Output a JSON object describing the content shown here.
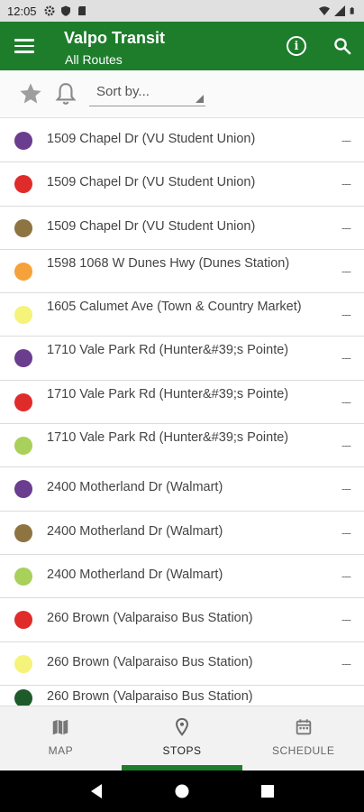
{
  "status_bar": {
    "time": "12:05"
  },
  "app_bar": {
    "title": "Valpo Transit",
    "subtitle": "All Routes"
  },
  "toolbar": {
    "sort_placeholder": "Sort by..."
  },
  "colors": {
    "primary": "#1d7d2b",
    "purple": "#6a3d8f",
    "red": "#e02b2b",
    "brown": "#8d7440",
    "orange": "#f5a23a",
    "yellow": "#f5f37a",
    "light_green": "#a9d05a",
    "dark_green": "#1e5a2a"
  },
  "stops": [
    {
      "name": "1509 Chapel Dr (VU Student Union)",
      "color": "#6a3d8f",
      "time": "---"
    },
    {
      "name": "1509 Chapel Dr (VU Student Union)",
      "color": "#e02b2b",
      "time": "---"
    },
    {
      "name": "1509 Chapel Dr (VU Student Union)",
      "color": "#8d7440",
      "time": "---"
    },
    {
      "name": "1598 1068 W Dunes Hwy (Dunes Station)",
      "color": "#f5a23a",
      "time": "---"
    },
    {
      "name": "1605 Calumet Ave (Town & Country Market)",
      "color": "#f5f37a",
      "time": "---"
    },
    {
      "name": "1710 Vale Park Rd (Hunter&#39;s Pointe)",
      "color": "#6a3d8f",
      "time": "---"
    },
    {
      "name": "1710 Vale Park Rd (Hunter&#39;s Pointe)",
      "color": "#e02b2b",
      "time": "---"
    },
    {
      "name": "1710 Vale Park Rd (Hunter&#39;s Pointe)",
      "color": "#a9d05a",
      "time": "---"
    },
    {
      "name": "2400 Motherland Dr (Walmart)",
      "color": "#6a3d8f",
      "time": "---"
    },
    {
      "name": "2400 Motherland Dr (Walmart)",
      "color": "#8d7440",
      "time": "---"
    },
    {
      "name": "2400 Motherland Dr (Walmart)",
      "color": "#a9d05a",
      "time": "---"
    },
    {
      "name": "260 Brown (Valparaiso Bus Station)",
      "color": "#e02b2b",
      "time": "---"
    },
    {
      "name": "260 Brown (Valparaiso Bus Station)",
      "color": "#f5f37a",
      "time": "---"
    },
    {
      "name": "260 Brown (Valparaiso Bus Station)",
      "color": "#1e5a2a",
      "time": ""
    }
  ],
  "bottom_nav": [
    {
      "label": "MAP",
      "icon": "map-icon",
      "active": false
    },
    {
      "label": "STOPS",
      "icon": "location-pin-icon",
      "active": true
    },
    {
      "label": "SCHEDULE",
      "icon": "calendar-icon",
      "active": false
    }
  ]
}
